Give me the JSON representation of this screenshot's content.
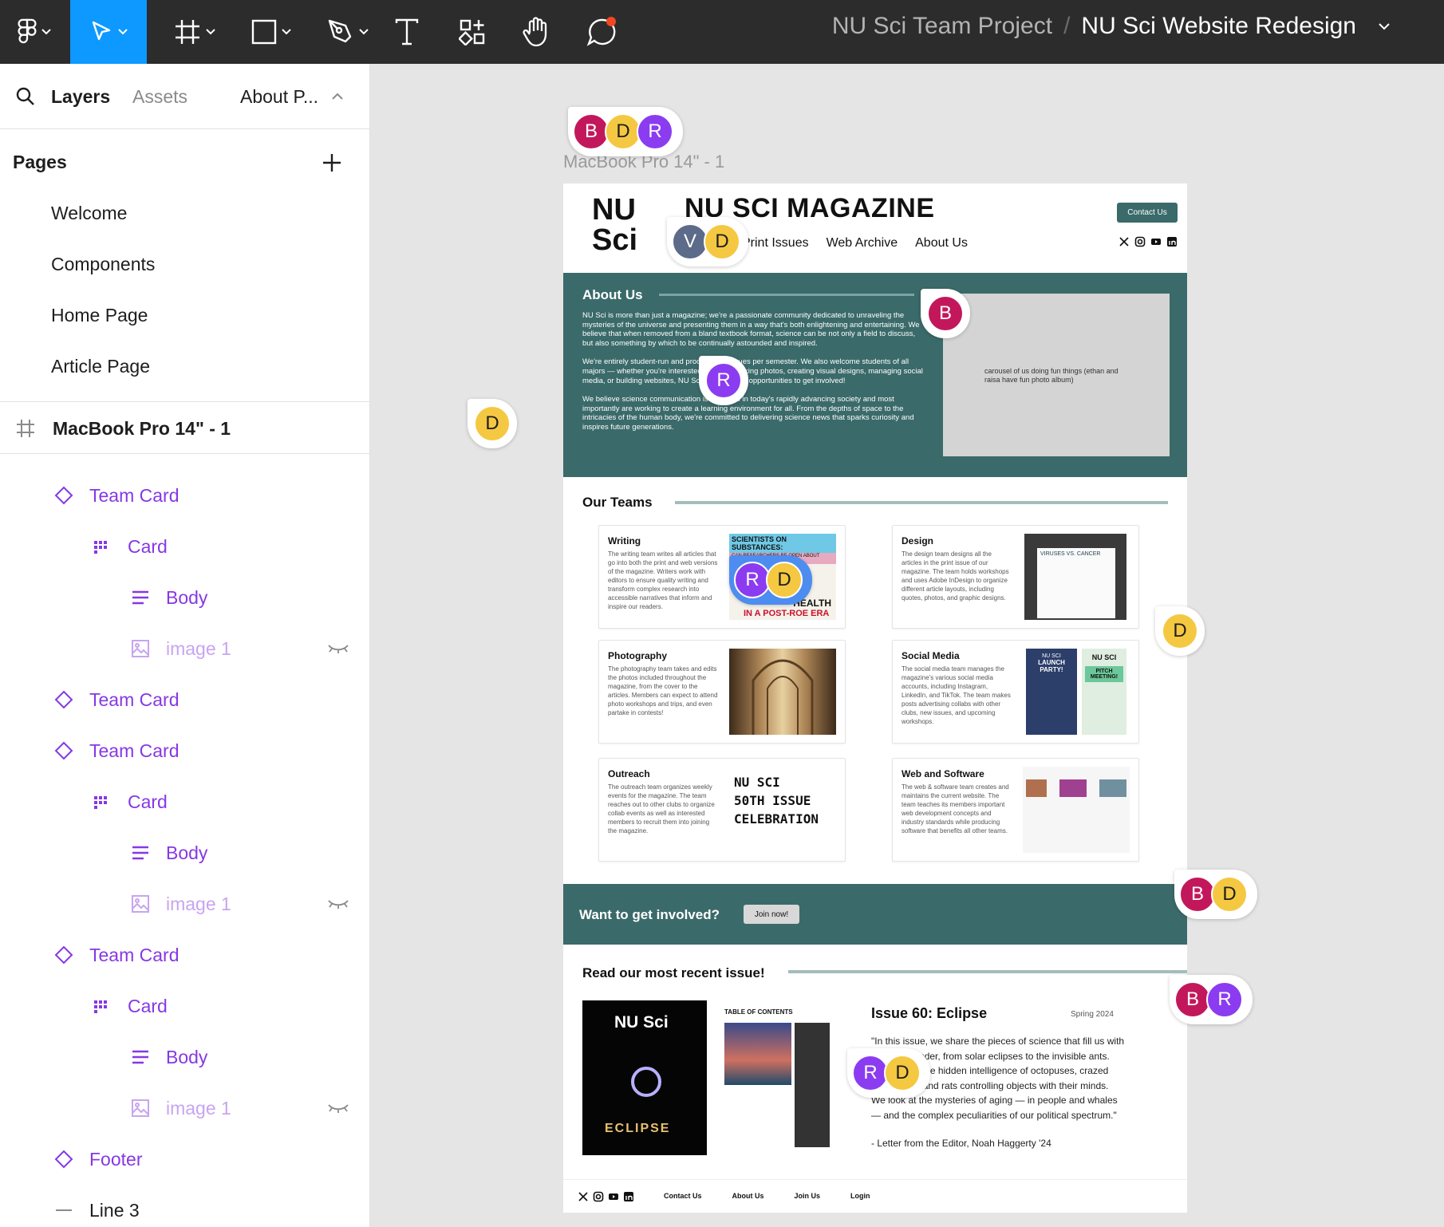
{
  "colors": {
    "toolbar_bg": "#2c2c2c",
    "accent_blue": "#0d99ff",
    "component_purple": "#8638e5",
    "teal": "#3b6a6a",
    "avatar_B": "#c2185b",
    "avatar_D": "#f5c842",
    "avatar_R": "#8b3cf0",
    "avatar_V": "#5c6b8a"
  },
  "toolbar": {
    "icons": [
      "figma-menu-icon",
      "move-tool-icon",
      "frame-tool-icon",
      "rectangle-tool-icon",
      "pen-tool-icon",
      "text-tool-icon",
      "resources-icon",
      "hand-tool-icon",
      "comment-icon"
    ],
    "breadcrumb_team": "NU Sci Team Project",
    "breadcrumb_sep": "/",
    "breadcrumb_file": "NU Sci Website Redesign"
  },
  "left_panel": {
    "tab_layers": "Layers",
    "tab_assets": "Assets",
    "page_selector": "About P...",
    "pages_heading": "Pages",
    "pages": [
      "Welcome",
      "Components",
      "Home Page",
      "Article Page"
    ],
    "frame_name": "MacBook Pro 14\" - 1",
    "layers": [
      {
        "label": "Team Card",
        "type": "component"
      },
      {
        "label": "Card",
        "type": "grid"
      },
      {
        "label": "Body",
        "type": "text"
      },
      {
        "label": "image 1",
        "type": "image",
        "hidden": true
      },
      {
        "label": "Team Card",
        "type": "component"
      },
      {
        "label": "Team Card",
        "type": "component"
      },
      {
        "label": "Card",
        "type": "grid"
      },
      {
        "label": "Body",
        "type": "text"
      },
      {
        "label": "image 1",
        "type": "image",
        "hidden": true
      },
      {
        "label": "Team Card",
        "type": "component"
      },
      {
        "label": "Card",
        "type": "grid"
      },
      {
        "label": "Body",
        "type": "text"
      },
      {
        "label": "image 1",
        "type": "image",
        "hidden": true
      },
      {
        "label": "Footer",
        "type": "component"
      },
      {
        "label": "Line 3",
        "type": "line"
      }
    ]
  },
  "canvas": {
    "frame_label": "MacBook Pro 14\" - 1"
  },
  "site": {
    "logo_line1": "NU",
    "logo_line2": "Sci",
    "title": "NU SCI MAGAZINE",
    "nav": [
      "Print Issues",
      "Web Archive",
      "About Us"
    ],
    "contact_button": "Contact Us",
    "social_icons": [
      "x-icon",
      "instagram-icon",
      "youtube-icon",
      "linkedin-icon"
    ],
    "about": {
      "heading": "About Us",
      "p1": "NU Sci is more than just a magazine; we're a passionate community dedicated to unraveling the mysteries of the universe and presenting them in a way that's both enlightening and entertaining. We believe that when removed from a bland textbook format, science can be not only a field to discuss, but also something by which to be continually astounded and inspired.",
      "p2": "We're entirely student-run and produce two issues per semester. We also welcome students of all majors — whether you're interested in writing, taking photos, creating visual designs, managing social media, or building websites, NU Sci has plenty of opportunities to get involved!",
      "p3": "We believe science communication is essential in today's rapidly advancing society and most importantly are working to create a learning environment for all. From the depths of space to the intricacies of the human body, we're committed to delivering science news that sparks curiosity and inspires future generations.",
      "carousel_note": "carousel of us doing fun things (ethan and raisa have fun photo album)"
    },
    "teams_heading": "Our Teams",
    "teams": [
      {
        "name": "Writing",
        "desc": "The writing team writes all articles that go into both the print and web versions of the magazine. Writers work with editors to ensure quality writing and transform complex research into accessible narratives that inform and inspire our readers.",
        "img_top": "SCIENTISTS ON SUBSTANCES:",
        "img_sub": "CAN RESEARCHERS BE OPEN ABOUT DRUG USE?",
        "img_bottom": "HEALTH",
        "img_bottom2": "IN A POST-ROE ERA"
      },
      {
        "name": "Design",
        "desc": "The design team designs all the articles in the print issue of our magazine. The team holds workshops and uses Adobe InDesign to organize different article layouts, including quotes, photos, and graphic designs.",
        "img_top": "VIRUSES VS. CANCER"
      },
      {
        "name": "Photography",
        "desc": "The photography team takes and edits the photos included throughout the magazine, from the cover to the articles. Members can expect to attend photo workshops and trips, and even partake in contests!"
      },
      {
        "name": "Social Media",
        "desc": "The social media team manages the magazine's various social media accounts, including Instagram, LinkedIn, and TikTok. The team makes posts advertising collabs with other clubs, new issues, and upcoming workshops.",
        "img_top": "NU SCI",
        "img_sub": "LAUNCH PARTY!",
        "img_top2": "NU SCI",
        "img_sub2": "PITCH MEETING!"
      },
      {
        "name": "Outreach",
        "desc": "The outreach team organizes weekly events for the magazine. The team reaches out to other clubs to organize collab events as well as interested members to recruit them into joining the magazine.",
        "img_line1": "NU SCI",
        "img_line2": "50TH ISSUE",
        "img_line3": "CELEBRATION"
      },
      {
        "name": "Web and Software",
        "desc": "The web & software team creates and maintains the current website. The team teaches its members important web development concepts and industry standards while producing software that benefits all other teams."
      }
    ],
    "involved_text": "Want to get involved?",
    "join_button": "Join now!",
    "recent_heading": "Read our most recent issue!",
    "issue": {
      "cover_title": "NU Sci",
      "cover_word": "ECLIPSE",
      "toc_title": "TABLE OF CONTENTS",
      "title": "Issue 60: Eclipse",
      "season": "Spring 2024",
      "quote": "\"In this issue, we share the pieces of science that fill us with sublime wonder, from solar eclipses to the invisible ants. We explore the hidden intelligence of octopuses, crazed marsupials, and rats controlling objects with their minds. We look at the mysteries of aging — in people and whales — and the complex peculiarities of our political spectrum.\"",
      "attribution": "- Letter from the Editor, Noah Haggerty '24"
    },
    "footer_links": [
      "Contact Us",
      "About Us",
      "Join Us",
      "Login"
    ]
  },
  "collaborators": {
    "header_group": [
      "B",
      "D",
      "R"
    ],
    "nav_group": [
      "V",
      "D"
    ],
    "about_b": "B",
    "about_r": "R",
    "left_d": "D",
    "writing_group": [
      "R",
      "D"
    ],
    "right_d": "D",
    "involved_group": [
      "B",
      "D"
    ],
    "recent_group": [
      "B",
      "R"
    ],
    "issue_group": [
      "R",
      "D"
    ]
  }
}
